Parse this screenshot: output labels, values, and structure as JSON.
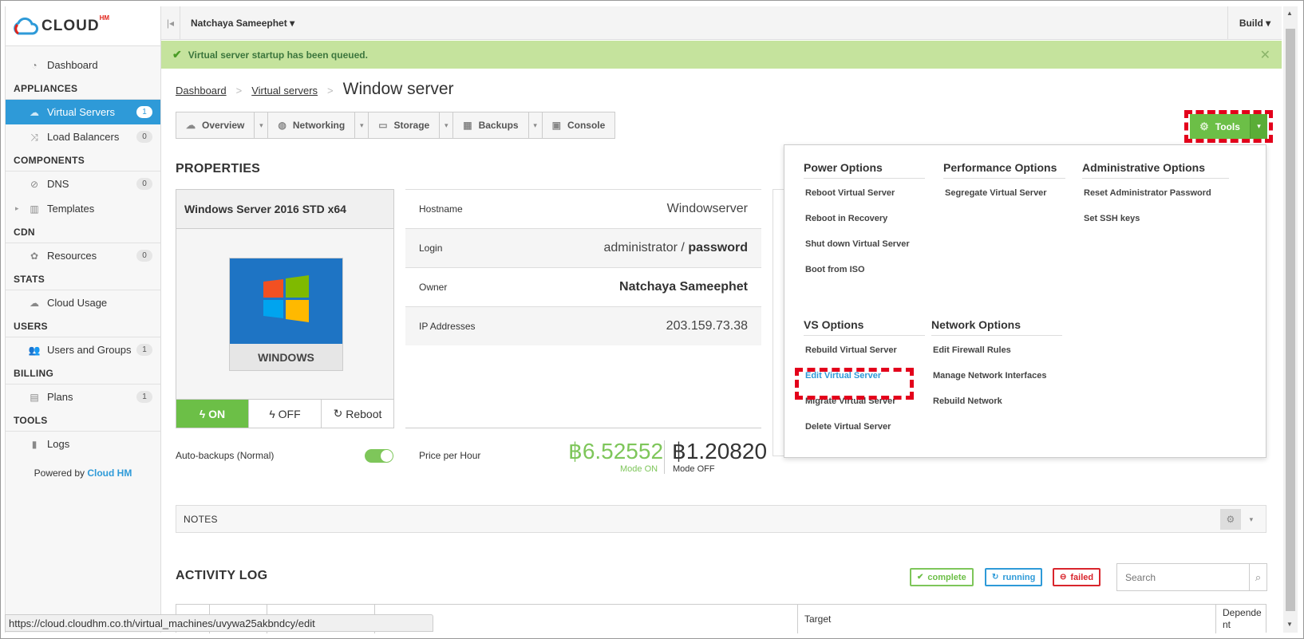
{
  "app": {
    "logo_text": "CLOUD",
    "logo_super": "HM",
    "powered_prefix": "Powered by ",
    "powered_brand": "Cloud HM"
  },
  "sidebar": {
    "items": [
      {
        "type": "item",
        "label": "Dashboard",
        "icon": "dashboard-icon"
      },
      {
        "type": "group",
        "label": "APPLIANCES"
      },
      {
        "type": "item",
        "label": "Virtual Servers",
        "count": "1",
        "active": true,
        "icon": "cloud-icon"
      },
      {
        "type": "item",
        "label": "Load Balancers",
        "count": "0",
        "icon": "load-balancer-icon"
      },
      {
        "type": "group",
        "label": "COMPONENTS"
      },
      {
        "type": "item",
        "label": "DNS",
        "count": "0",
        "icon": "dns-icon"
      },
      {
        "type": "item",
        "label": "Templates",
        "icon": "templates-icon",
        "expandable": true
      },
      {
        "type": "group",
        "label": "CDN"
      },
      {
        "type": "item",
        "label": "Resources",
        "count": "0",
        "icon": "resources-icon"
      },
      {
        "type": "group",
        "label": "STATS"
      },
      {
        "type": "item",
        "label": "Cloud Usage",
        "icon": "cloud-usage-icon"
      },
      {
        "type": "group",
        "label": "USERS"
      },
      {
        "type": "item",
        "label": "Users and Groups",
        "count": "1",
        "icon": "users-icon"
      },
      {
        "type": "group",
        "label": "BILLING"
      },
      {
        "type": "item",
        "label": "Plans",
        "count": "1",
        "icon": "plans-icon"
      },
      {
        "type": "group",
        "label": "TOOLS"
      },
      {
        "type": "item",
        "label": "Logs",
        "icon": "logs-icon"
      }
    ]
  },
  "topbar": {
    "user": "Natchaya Sameephet",
    "build": "Build"
  },
  "alert": {
    "message": "Virtual server startup has been queued."
  },
  "breadcrumb": {
    "home": "Dashboard",
    "parent": "Virtual servers",
    "current": "Window server"
  },
  "tabs": [
    {
      "label": "Overview",
      "icon": "cloud-icon"
    },
    {
      "label": "Networking",
      "icon": "globe-icon"
    },
    {
      "label": "Storage",
      "icon": "storage-icon"
    },
    {
      "label": "Backups",
      "icon": "backups-icon"
    },
    {
      "label": "Console",
      "icon": "console-icon"
    }
  ],
  "tools": {
    "label": "Tools"
  },
  "properties": {
    "title": "PROPERTIES",
    "os_name": "Windows Server 2016 STD x64",
    "os_label": "WINDOWS",
    "power": {
      "on": "ON",
      "off": "OFF",
      "reboot": "Reboot"
    },
    "rows": [
      {
        "label": "Hostname",
        "value": "Windowserver"
      },
      {
        "label": "Login",
        "value_user": "administrator",
        "value_sep": " / ",
        "value_pass": "password"
      },
      {
        "label": "Owner",
        "value": "Natchaya Sameephet"
      },
      {
        "label": "IP Addresses",
        "value": "203.159.73.38"
      }
    ],
    "auto_backups": "Auto-backups (Normal)",
    "price_label": "Price per Hour",
    "price_on": "฿6.52552",
    "price_on_sub": "Mode ON",
    "price_off": "฿1.20820",
    "price_off_sub": "Mode OFF"
  },
  "tools_menu": {
    "power": {
      "title": "Power Options",
      "items": [
        "Reboot Virtual Server",
        "Reboot in Recovery",
        "Shut down Virtual Server",
        "Boot from ISO"
      ]
    },
    "performance": {
      "title": "Performance Options",
      "items": [
        "Segregate Virtual Server"
      ]
    },
    "admin": {
      "title": "Administrative Options",
      "items": [
        "Reset Administrator Password",
        "Set SSH keys"
      ]
    },
    "vs": {
      "title": "VS Options",
      "items": [
        "Rebuild Virtual Server",
        "Edit Virtual Server",
        "Migrate Virtual Server",
        "Delete Virtual Server"
      ]
    },
    "network": {
      "title": "Network Options",
      "items": [
        "Edit Firewall Rules",
        "Manage Network Interfaces",
        "Rebuild Network"
      ]
    }
  },
  "notes": {
    "title": "NOTES"
  },
  "activity": {
    "title": "ACTIVITY LOG",
    "legend": {
      "complete": "complete",
      "running": "running",
      "failed": "failed"
    },
    "search_placeholder": "Search",
    "columns": {
      "target": "Target",
      "dependent": "Depende nt"
    }
  },
  "status_url": "https://cloud.cloudhm.co.th/virtual_machines/uvywa25akbndcy/edit",
  "colors": {
    "accent": "#2e9ad8",
    "green": "#6cbf47",
    "alert_bg": "#c5e39d",
    "red_dash": "#e3001b"
  }
}
